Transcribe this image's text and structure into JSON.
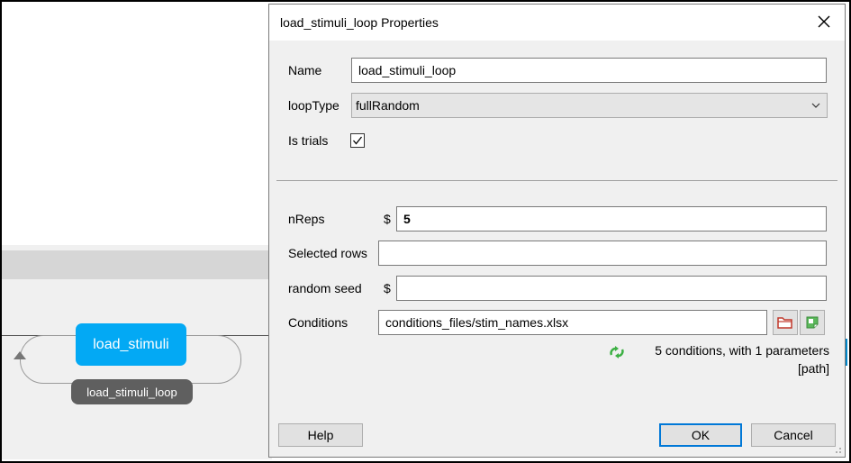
{
  "flow": {
    "routine_label": "load_stimuli",
    "loop_label": "load_stimuli_loop"
  },
  "dialog": {
    "title": "load_stimuli_loop Properties",
    "fields": {
      "name_label": "Name",
      "name_value": "load_stimuli_loop",
      "looptype_label": "loopType",
      "looptype_value": "fullRandom",
      "istrials_label": "Is trials",
      "istrials_checked": true,
      "nreps_label": "nReps",
      "nreps_prefix": "$",
      "nreps_value": "5",
      "selected_rows_label": "Selected rows",
      "selected_rows_value": "",
      "random_seed_label": "random seed",
      "random_seed_prefix": "$",
      "random_seed_value": "",
      "conditions_label": "Conditions",
      "conditions_value": "conditions_files/stim_names.xlsx"
    },
    "conditions_info_line1": "5 conditions, with 1 parameters",
    "conditions_info_line2": "[path]",
    "buttons": {
      "help": "Help",
      "ok": "OK",
      "cancel": "Cancel"
    },
    "icons": {
      "close": "close-icon",
      "open_file": "folder-open-icon",
      "edit_file": "edit-file-icon",
      "refresh": "refresh-icon"
    }
  },
  "colors": {
    "routine": "#03a9f4",
    "loop_label_bg": "#5f5f5f",
    "refresh": "#3cb043",
    "default_button_border": "#0078d7"
  }
}
